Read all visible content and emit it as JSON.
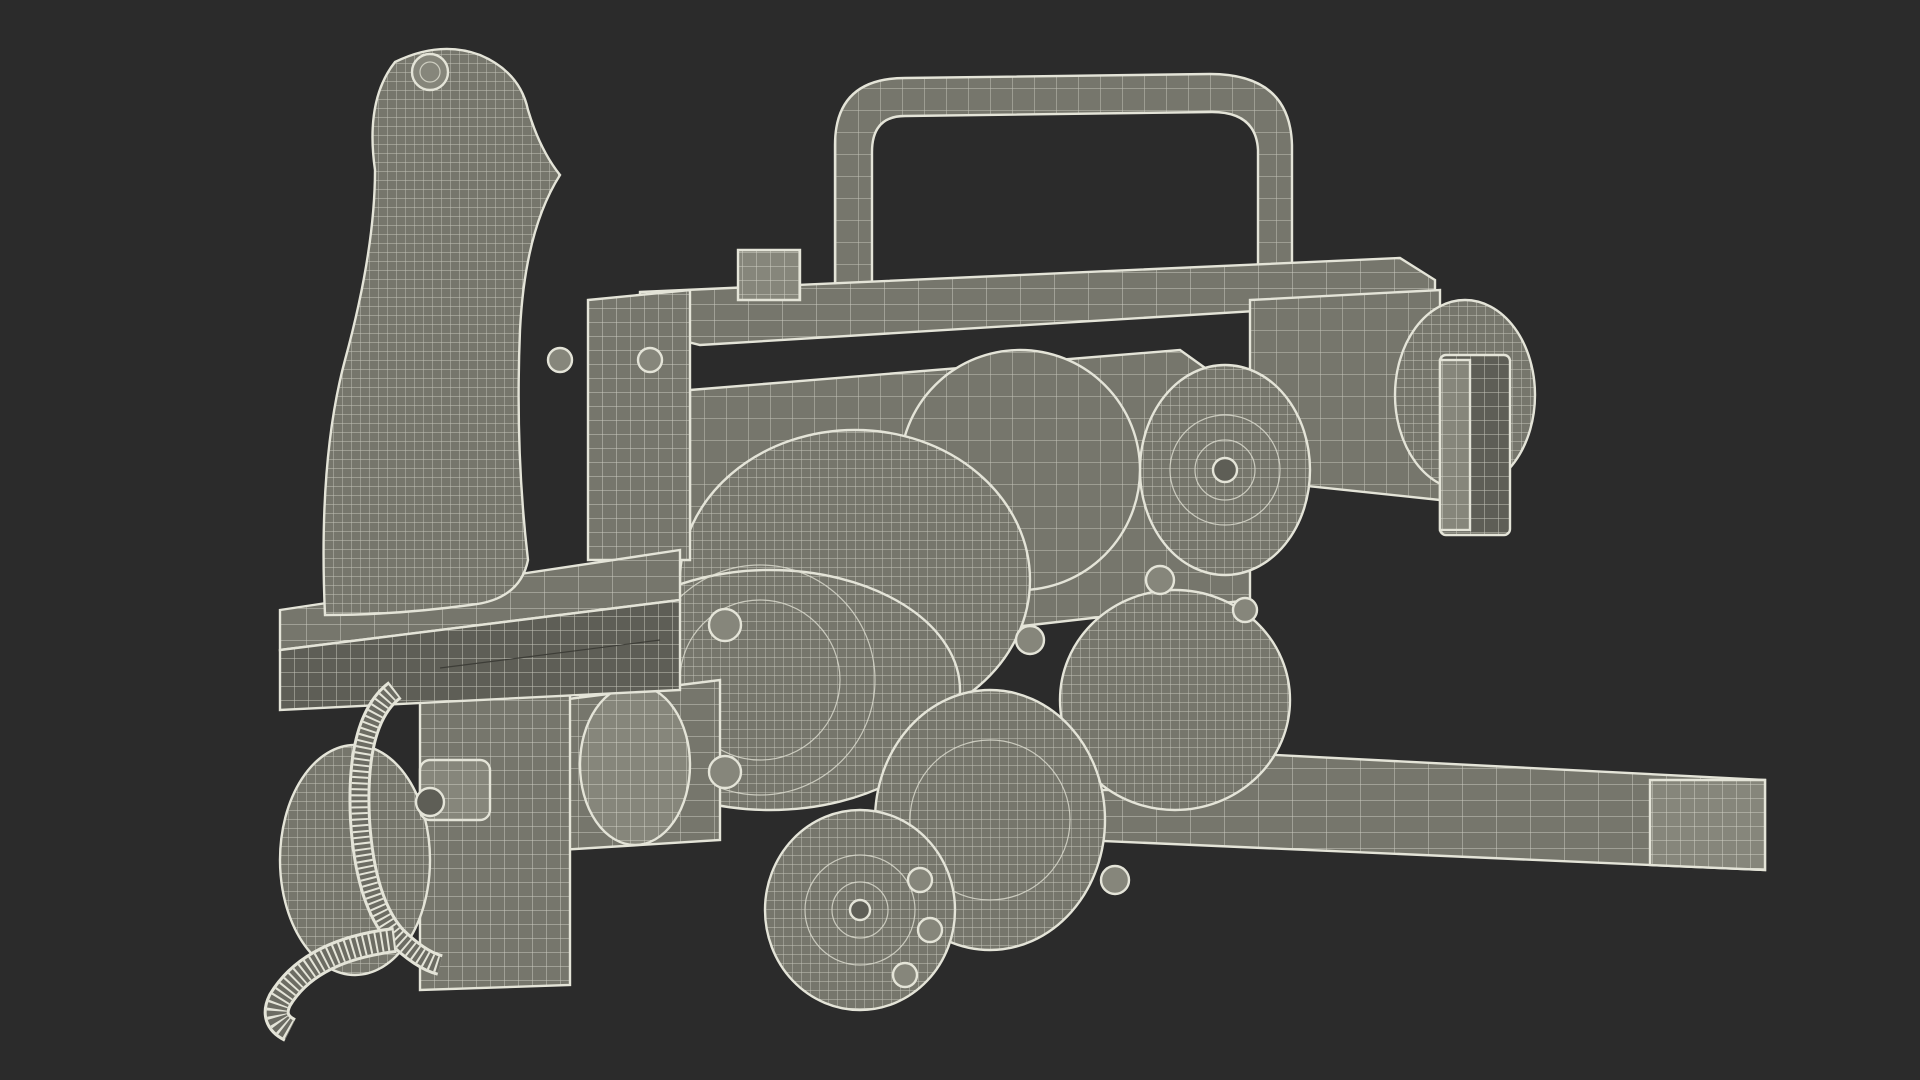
{
  "scene": {
    "background_color": "#2b2b2b",
    "mesh_fill_color": "#76766c",
    "wire_color": "#e4e4d8"
  }
}
